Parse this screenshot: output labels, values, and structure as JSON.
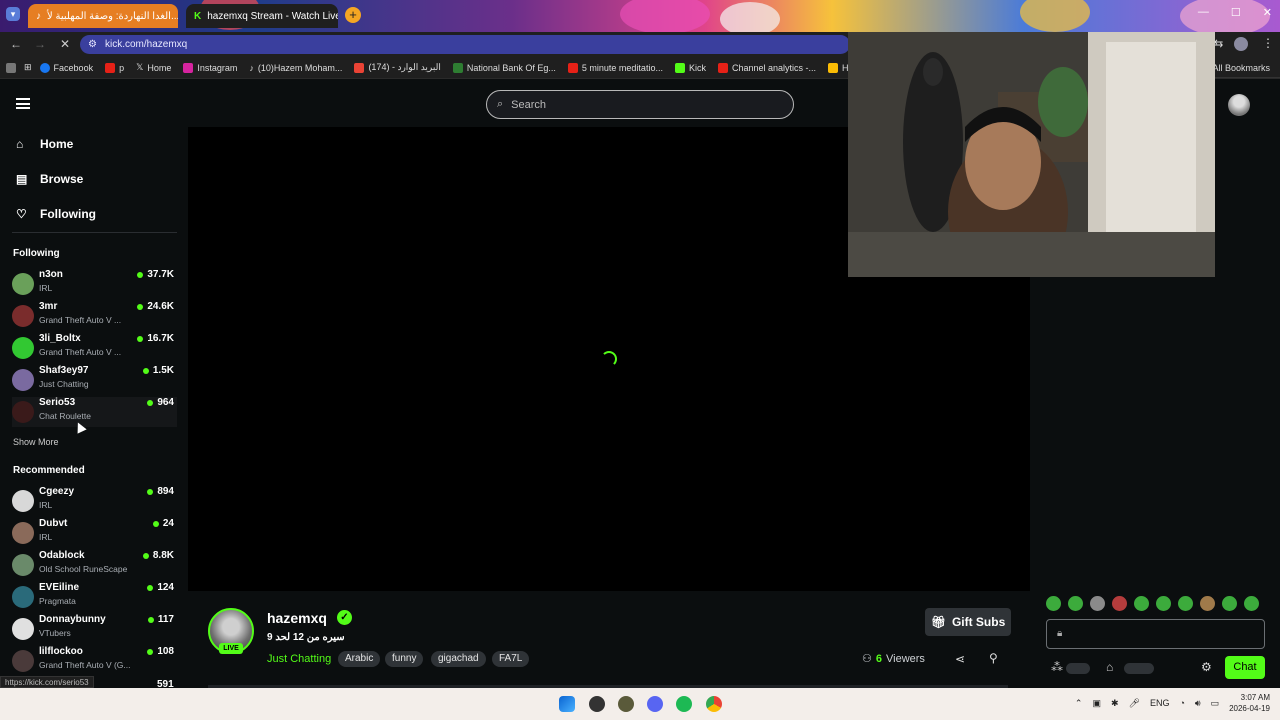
{
  "browser": {
    "tabs": [
      {
        "label": "الغدا النهاردة: وصفة المهلبية لأ...",
        "active": false
      },
      {
        "label": "hazemxq Stream - Watch Live o",
        "active": true
      }
    ],
    "new_tab": "+",
    "url": "kick.com/hazemxq",
    "bookmarks": [
      "Facebook",
      "p",
      "Home",
      "Instagram",
      "(10)Hazem Moham...",
      "(174) - البريد الوارد",
      "National Bank Of Eg...",
      "5 minute meditatio...",
      "Kick",
      "Channel analytics -...",
      "Home"
    ],
    "all_bookmarks": "All Bookmarks"
  },
  "kick": {
    "search_placeholder": "Search",
    "nav": {
      "home": "Home",
      "browse": "Browse",
      "following": "Following"
    },
    "following_heading": "Following",
    "following": [
      {
        "name": "n3on",
        "category": "IRL",
        "viewers": "37.7K",
        "color": "#6aa05a"
      },
      {
        "name": "3mr",
        "category": "Grand Theft Auto V ...",
        "viewers": "24.6K",
        "color": "#7a2c2c"
      },
      {
        "name": "3li_Boltx",
        "category": "Grand Theft Auto V ...",
        "viewers": "16.7K",
        "color": "#32c832"
      },
      {
        "name": "Shaf3ey97",
        "category": "Just Chatting",
        "viewers": "1.5K",
        "color": "#7a6aa0"
      },
      {
        "name": "Serio53",
        "category": "Chat Roulette",
        "viewers": "964",
        "color": "#3a1a1a"
      }
    ],
    "show_more": "Show More",
    "recommended_heading": "Recommended",
    "recommended": [
      {
        "name": "Cgeezy",
        "category": "IRL",
        "viewers": "894",
        "color": "#d8d8d8"
      },
      {
        "name": "Dubvt",
        "category": "IRL",
        "viewers": "24",
        "color": "#8a6a5a"
      },
      {
        "name": "Odablock",
        "category": "Old School RuneScape",
        "viewers": "8.8K",
        "color": "#6a8a6a"
      },
      {
        "name": "EVEiline",
        "category": "Pragmata",
        "viewers": "124",
        "color": "#2a6a7a"
      },
      {
        "name": "Donnaybunny",
        "category": "VTubers",
        "viewers": "117",
        "color": "#e0e0e0"
      },
      {
        "name": "lilflockoo",
        "category": "Grand Theft Auto V (G...",
        "viewers": "108",
        "color": "#4a3a3a"
      }
    ],
    "partial_viewers": "591",
    "status_url": "https://kick.com/serio53",
    "stream": {
      "streamer": "hazemxq",
      "live_badge": "LIVE",
      "title": "سيره من 12 لحد 9",
      "category": "Just Chatting",
      "tags": [
        "Arabic",
        "funny",
        "gigachad",
        "FA7L"
      ],
      "gift_subs": "Gift Subs",
      "viewers_count": "6",
      "viewers_label": "Viewers"
    },
    "chat": {
      "button": "Chat"
    }
  },
  "taskbar": {
    "lang": "ENG",
    "time": "3:07 AM",
    "date": "2026-04-19"
  },
  "colors": {
    "accent": "#53fc18"
  }
}
